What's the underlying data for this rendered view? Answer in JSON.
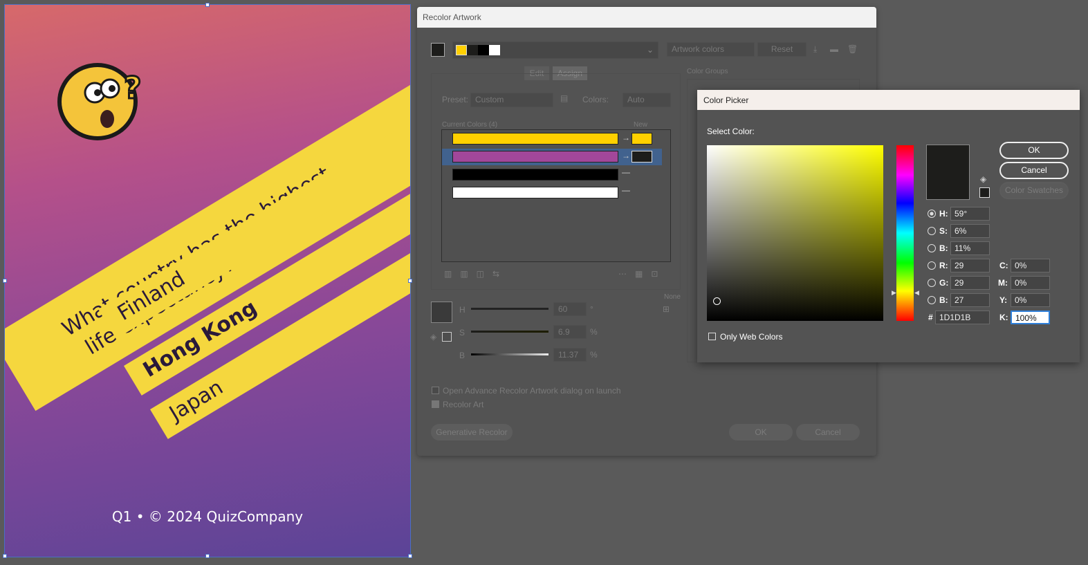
{
  "artboard": {
    "question": [
      "What country has the highest",
      "life expectancy?"
    ],
    "answers": [
      "Finland",
      "Hong Kong",
      "Japan"
    ],
    "footer": "Q1 • © 2024 QuizCompany",
    "colors": {
      "band": "#f5d73e",
      "gradient_top": "#d7696a",
      "gradient_bottom": "#5b4497"
    }
  },
  "recolor": {
    "title": "Recolor Artwork",
    "artwork_colors_label": "Artwork colors",
    "reset_label": "Reset",
    "tabs": [
      "Edit",
      "Assign"
    ],
    "color_groups_label": "Color Groups",
    "preset_label": "Preset:",
    "preset_value": "Custom",
    "colors_label": "Colors:",
    "colors_value": "Auto",
    "current_colors_label": "Current Colors (4)",
    "new_label": "New",
    "none_label": "None",
    "current_colors": [
      "#ffd000",
      "#a2479a",
      "#000000",
      "#ffffff"
    ],
    "hsb": {
      "h_label": "H",
      "h_value": "60",
      "h_unit": "°",
      "s_label": "S",
      "s_value": "6.9",
      "s_unit": "%",
      "b_label": "B",
      "b_value": "11.37",
      "b_unit": "%"
    },
    "open_advance_label": "Open Advance Recolor Artwork dialog on launch",
    "recolor_art_label": "Recolor Art",
    "generative_label": "Generative Recolor",
    "ok_label": "OK",
    "cancel_label": "Cancel"
  },
  "picker": {
    "title": "Color Picker",
    "select_color_label": "Select Color:",
    "ok_label": "OK",
    "cancel_label": "Cancel",
    "swatches_label": "Color Swatches",
    "only_web_label": "Only Web Colors",
    "fields": {
      "h": {
        "label": "H:",
        "value": "59°"
      },
      "s": {
        "label": "S:",
        "value": "6%"
      },
      "b": {
        "label": "B:",
        "value": "11%"
      },
      "r": {
        "label": "R:",
        "value": "29"
      },
      "g": {
        "label": "G:",
        "value": "29"
      },
      "b2": {
        "label": "B:",
        "value": "27"
      },
      "hex": {
        "label": "#",
        "value": "1D1D1B"
      },
      "c": {
        "label": "C:",
        "value": "0%"
      },
      "m": {
        "label": "M:",
        "value": "0%"
      },
      "y": {
        "label": "Y:",
        "value": "0%"
      },
      "k": {
        "label": "K:",
        "value": "100%"
      }
    },
    "current_color": "#1d1d1b"
  }
}
